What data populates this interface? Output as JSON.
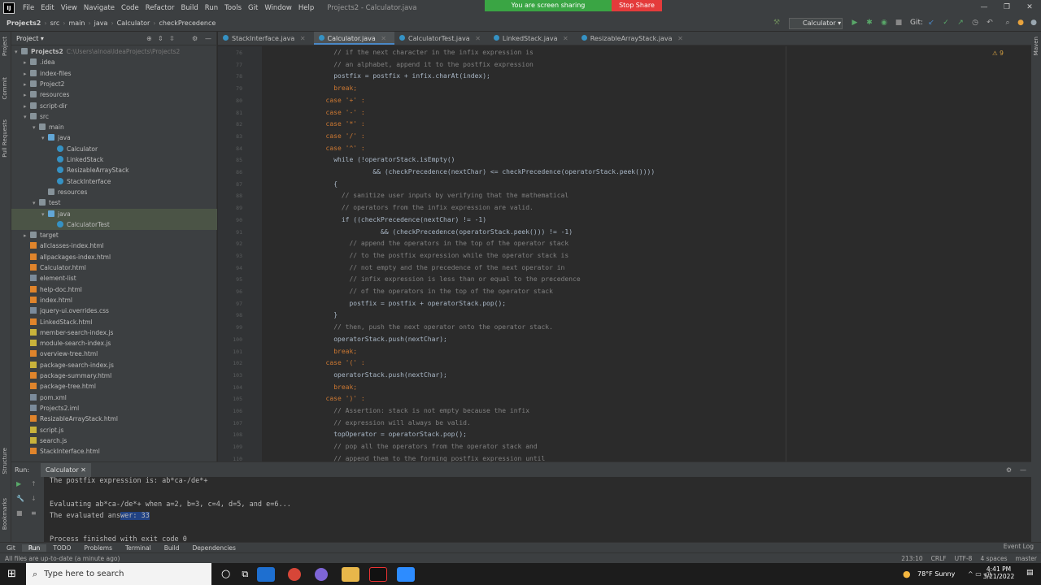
{
  "window": {
    "title": "Projects2 - Calculator.java"
  },
  "menu": [
    "File",
    "Edit",
    "View",
    "Navigate",
    "Code",
    "Refactor",
    "Build",
    "Run",
    "Tools",
    "Git",
    "Window",
    "Help"
  ],
  "sharing": {
    "status": "You are screen sharing",
    "stop": "Stop Share"
  },
  "breadcrumb": [
    "Projects2",
    "src",
    "main",
    "java",
    "Calculator",
    "checkPrecedence"
  ],
  "run_config": "Calculator",
  "git_label": "Git:",
  "project_panel": {
    "title": "Project"
  },
  "left_strip": [
    "Project",
    "Commit",
    "Pull Requests",
    "Structure",
    "Bookmarks"
  ],
  "tree": [
    {
      "label": "Projects2",
      "extra": "C:\\Users\\alnoa\\IdeaProjects\\Projects2",
      "depth": 0,
      "type": "folder",
      "arrow": "▾"
    },
    {
      "label": ".idea",
      "depth": 1,
      "type": "folder",
      "arrow": "▸"
    },
    {
      "label": "index-files",
      "depth": 1,
      "type": "folder",
      "arrow": "▸"
    },
    {
      "label": "Project2",
      "depth": 1,
      "type": "folder",
      "arrow": "▸"
    },
    {
      "label": "resources",
      "depth": 1,
      "type": "folder",
      "arrow": "▸"
    },
    {
      "label": "script-dir",
      "depth": 1,
      "type": "folder",
      "arrow": "▸"
    },
    {
      "label": "src",
      "depth": 1,
      "type": "folder",
      "arrow": "▾"
    },
    {
      "label": "main",
      "depth": 2,
      "type": "folder",
      "arrow": "▾"
    },
    {
      "label": "java",
      "depth": 3,
      "type": "jfolder",
      "arrow": "▾"
    },
    {
      "label": "Calculator",
      "depth": 4,
      "type": "class",
      "arrow": ""
    },
    {
      "label": "LinkedStack",
      "depth": 4,
      "type": "class",
      "arrow": ""
    },
    {
      "label": "ResizableArrayStack",
      "depth": 4,
      "type": "class",
      "arrow": ""
    },
    {
      "label": "StackInterface",
      "depth": 4,
      "type": "class",
      "arrow": ""
    },
    {
      "label": "resources",
      "depth": 3,
      "type": "folder",
      "arrow": ""
    },
    {
      "label": "test",
      "depth": 2,
      "type": "folder",
      "arrow": "▾"
    },
    {
      "label": "java",
      "depth": 3,
      "type": "jfolder",
      "arrow": "▾",
      "selected": true
    },
    {
      "label": "CalculatorTest",
      "depth": 4,
      "type": "class",
      "arrow": "",
      "selected": true
    },
    {
      "label": "target",
      "depth": 1,
      "type": "folder",
      "arrow": "▸"
    },
    {
      "label": "allclasses-index.html",
      "depth": 1,
      "type": "html",
      "arrow": ""
    },
    {
      "label": "allpackages-index.html",
      "depth": 1,
      "type": "html",
      "arrow": ""
    },
    {
      "label": "Calculator.html",
      "depth": 1,
      "type": "html",
      "arrow": ""
    },
    {
      "label": "element-list",
      "depth": 1,
      "type": "file",
      "arrow": ""
    },
    {
      "label": "help-doc.html",
      "depth": 1,
      "type": "html",
      "arrow": ""
    },
    {
      "label": "index.html",
      "depth": 1,
      "type": "html",
      "arrow": ""
    },
    {
      "label": "jquery-ui.overrides.css",
      "depth": 1,
      "type": "file",
      "arrow": ""
    },
    {
      "label": "LinkedStack.html",
      "depth": 1,
      "type": "html",
      "arrow": ""
    },
    {
      "label": "member-search-index.js",
      "depth": 1,
      "type": "js",
      "arrow": ""
    },
    {
      "label": "module-search-index.js",
      "depth": 1,
      "type": "js",
      "arrow": ""
    },
    {
      "label": "overview-tree.html",
      "depth": 1,
      "type": "html",
      "arrow": ""
    },
    {
      "label": "package-search-index.js",
      "depth": 1,
      "type": "js",
      "arrow": ""
    },
    {
      "label": "package-summary.html",
      "depth": 1,
      "type": "html",
      "arrow": ""
    },
    {
      "label": "package-tree.html",
      "depth": 1,
      "type": "html",
      "arrow": ""
    },
    {
      "label": "pom.xml",
      "depth": 1,
      "type": "file",
      "arrow": ""
    },
    {
      "label": "Projects2.iml",
      "depth": 1,
      "type": "file",
      "arrow": ""
    },
    {
      "label": "ResizableArrayStack.html",
      "depth": 1,
      "type": "html",
      "arrow": ""
    },
    {
      "label": "script.js",
      "depth": 1,
      "type": "js",
      "arrow": ""
    },
    {
      "label": "search.js",
      "depth": 1,
      "type": "js",
      "arrow": ""
    },
    {
      "label": "StackInterface.html",
      "depth": 1,
      "type": "html",
      "arrow": ""
    }
  ],
  "tabs": [
    {
      "label": "StackInterface.java"
    },
    {
      "label": "Calculator.java",
      "active": true
    },
    {
      "label": "CalculatorTest.java"
    },
    {
      "label": "LinkedStack.java"
    },
    {
      "label": "ResizableArrayStack.java"
    }
  ],
  "warnings": "⚠ 9",
  "code": [
    {
      "n": "76",
      "t": "// if the next character in the infix expression is",
      "i": 10,
      "c": "cm"
    },
    {
      "n": "77",
      "t": "// an alphabet, append it to the postfix expression",
      "i": 10,
      "c": "cm"
    },
    {
      "n": "78",
      "t": "postfix = postfix + infix.charAt(index);",
      "i": 10,
      "c": ""
    },
    {
      "n": "79",
      "t": "break;",
      "i": 10,
      "c": "kw"
    },
    {
      "n": "80",
      "t": "case '+' :",
      "i": 8,
      "c": "kw"
    },
    {
      "n": "81",
      "t": "case '-' :",
      "i": 8,
      "c": "kw"
    },
    {
      "n": "82",
      "t": "case '*' :",
      "i": 8,
      "c": "kw"
    },
    {
      "n": "83",
      "t": "case '/' :",
      "i": 8,
      "c": "kw"
    },
    {
      "n": "84",
      "t": "case '^' :",
      "i": 8,
      "c": "kw"
    },
    {
      "n": "85",
      "t": "while (!operatorStack.isEmpty()",
      "i": 10,
      "c": ""
    },
    {
      "n": "86",
      "t": "&& (checkPrecedence(nextChar) <= checkPrecedence(operatorStack.peek())))",
      "i": 20,
      "c": ""
    },
    {
      "n": "87",
      "t": "{",
      "i": 10,
      "c": ""
    },
    {
      "n": "88",
      "t": "// sanitize user inputs by verifying that the mathematical",
      "i": 12,
      "c": "cm"
    },
    {
      "n": "89",
      "t": "// operators from the infix expression are valid.",
      "i": 12,
      "c": "cm"
    },
    {
      "n": "90",
      "t": "if ((checkPrecedence(nextChar) != -1)",
      "i": 12,
      "c": ""
    },
    {
      "n": "91",
      "t": "&& (checkPrecedence(operatorStack.peek())) != -1)",
      "i": 22,
      "c": ""
    },
    {
      "n": "92",
      "t": "// append the operators in the top of the operator stack",
      "i": 14,
      "c": "cm"
    },
    {
      "n": "93",
      "t": "// to the postfix expression while the operator stack is",
      "i": 14,
      "c": "cm"
    },
    {
      "n": "94",
      "t": "// not empty and the precedence of the next operator in",
      "i": 14,
      "c": "cm"
    },
    {
      "n": "95",
      "t": "// infix expression is less than or equal to the precedence",
      "i": 14,
      "c": "cm"
    },
    {
      "n": "96",
      "t": "// of the operators in the top of the operator stack",
      "i": 14,
      "c": "cm"
    },
    {
      "n": "97",
      "t": "postfix = postfix + operatorStack.pop();",
      "i": 14,
      "c": ""
    },
    {
      "n": "98",
      "t": "}",
      "i": 10,
      "c": ""
    },
    {
      "n": "99",
      "t": "// then, push the next operator onto the operator stack.",
      "i": 10,
      "c": "cm"
    },
    {
      "n": "100",
      "t": "operatorStack.push(nextChar);",
      "i": 10,
      "c": ""
    },
    {
      "n": "101",
      "t": "break;",
      "i": 10,
      "c": "kw"
    },
    {
      "n": "102",
      "t": "case '(' :",
      "i": 8,
      "c": "kw"
    },
    {
      "n": "103",
      "t": "operatorStack.push(nextChar);",
      "i": 10,
      "c": ""
    },
    {
      "n": "104",
      "t": "break;",
      "i": 10,
      "c": "kw"
    },
    {
      "n": "105",
      "t": "case ')' :",
      "i": 8,
      "c": "kw"
    },
    {
      "n": "106",
      "t": "// Assertion: stack is not empty because the infix",
      "i": 10,
      "c": "cm"
    },
    {
      "n": "107",
      "t": "// expression will always be valid.",
      "i": 10,
      "c": "cm"
    },
    {
      "n": "108",
      "t": "topOperator = operatorStack.pop();",
      "i": 10,
      "c": ""
    },
    {
      "n": "109",
      "t": "// pop all the operators from the operator stack and",
      "i": 10,
      "c": "cm"
    },
    {
      "n": "110",
      "t": "// append them to the forming postfix expression until",
      "i": 10,
      "c": "cm"
    }
  ],
  "run_panel": {
    "label": "Run:",
    "tab": "Calculator"
  },
  "console": [
    "The postfix expression is: ab*ca-/de*+",
    "",
    "Evaluating ab*ca-/de*+ when a=2, b=3, c=4, d=5, and e=6...",
    "The evaluated answer: 33",
    "",
    "Process finished with exit code 0"
  ],
  "bottom_tabs": [
    "Git",
    "Run",
    "TODO",
    "Problems",
    "Terminal",
    "Build",
    "Dependencies"
  ],
  "status": {
    "left": "All files are up-to-date (a minute ago)",
    "position": "213:10",
    "line_sep": "CRLF",
    "encoding": "UTF-8",
    "indent": "4 spaces",
    "branch": "master",
    "event_log": "Event Log"
  },
  "taskbar": {
    "search_placeholder": "Type here to search",
    "weather": "78°F  Sunny",
    "time": "4:41 PM",
    "date": "3/21/2022"
  }
}
